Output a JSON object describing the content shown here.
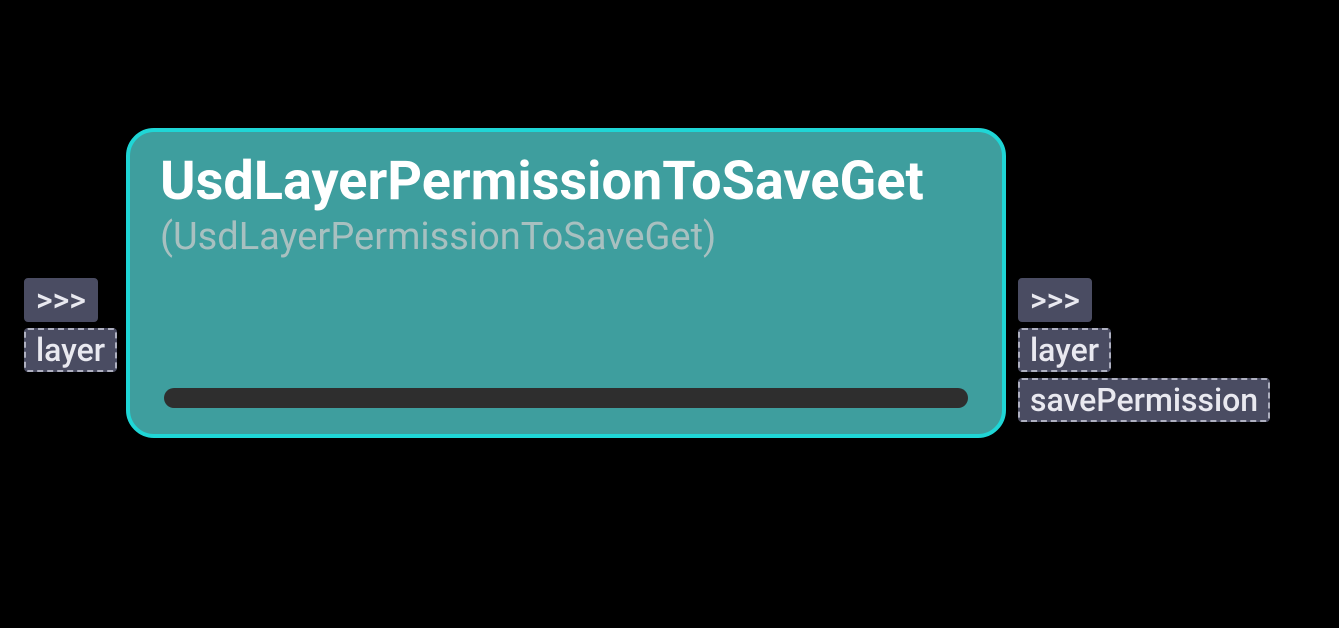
{
  "node": {
    "title": "UsdLayerPermissionToSaveGet",
    "subtitle": "(UsdLayerPermissionToSaveGet)"
  },
  "inputs": {
    "exec": ">>>",
    "layer": "layer"
  },
  "outputs": {
    "exec": ">>>",
    "layer": "layer",
    "savePermission": "savePermission"
  }
}
